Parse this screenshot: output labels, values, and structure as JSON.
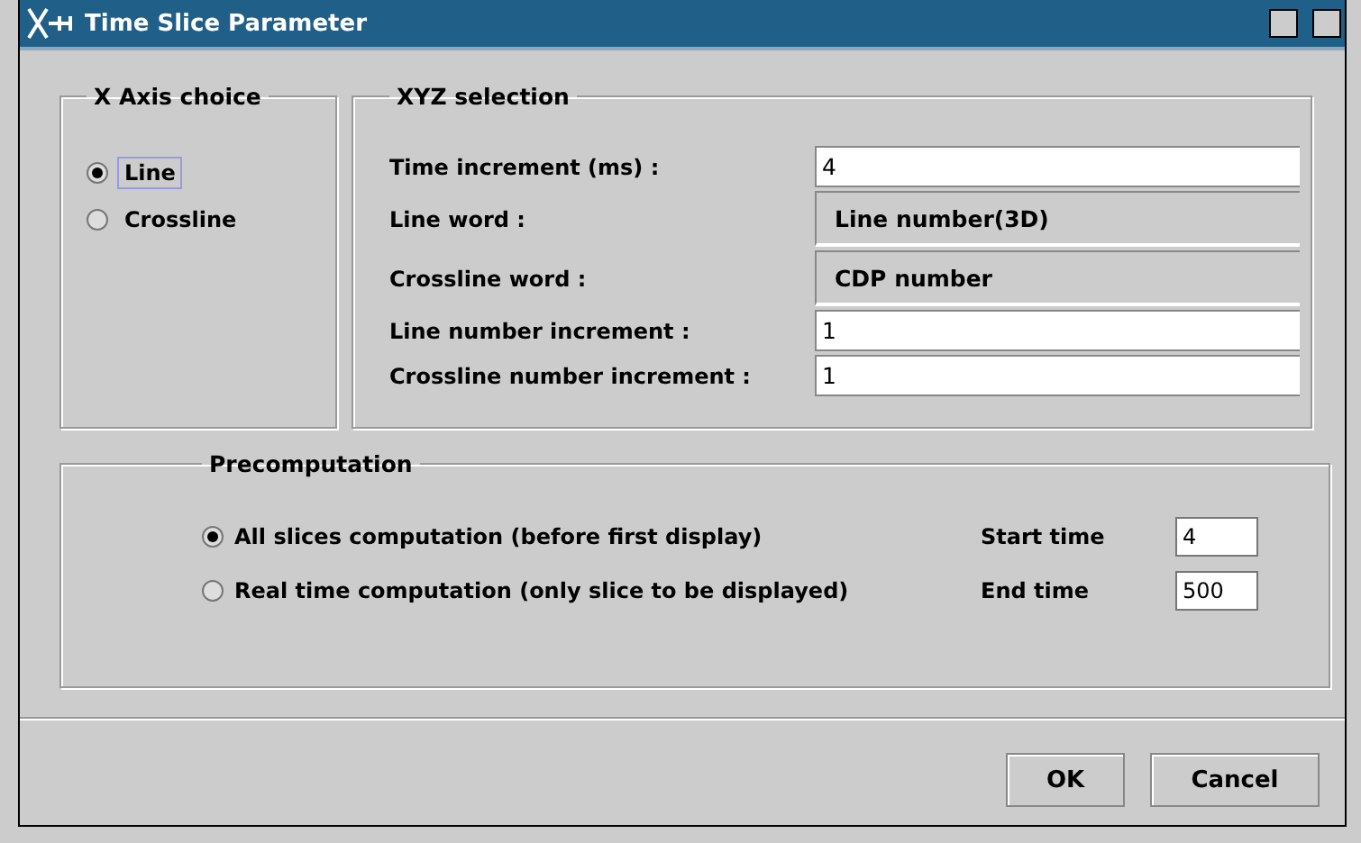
{
  "window": {
    "title": "Time Slice Parameter"
  },
  "x_axis_choice": {
    "title": "X Axis choice",
    "options": [
      {
        "label": "Line",
        "selected": true
      },
      {
        "label": "Crossline",
        "selected": false
      }
    ]
  },
  "xyz_selection": {
    "title": "XYZ selection",
    "fields": [
      {
        "label": "Time increment (ms) :",
        "value": "4",
        "kind": "editable"
      },
      {
        "label": "Line word :",
        "value": "Line number(3D)",
        "kind": "readonly"
      },
      {
        "label": "Crossline word :",
        "value": "CDP number",
        "kind": "readonly"
      },
      {
        "label": "Line number increment :",
        "value": "1",
        "kind": "editable"
      },
      {
        "label": "Crossline number increment :",
        "value": "1",
        "kind": "editable"
      }
    ]
  },
  "precomputation": {
    "title": "Precomputation",
    "options": [
      {
        "label": "All slices computation (before first display)",
        "selected": true,
        "time_label": "Start time",
        "time_value": "4"
      },
      {
        "label": "Real time computation (only slice to be displayed)",
        "selected": false,
        "time_label": "End time",
        "time_value": "500"
      }
    ]
  },
  "buttons": [
    "OK",
    "Cancel"
  ]
}
